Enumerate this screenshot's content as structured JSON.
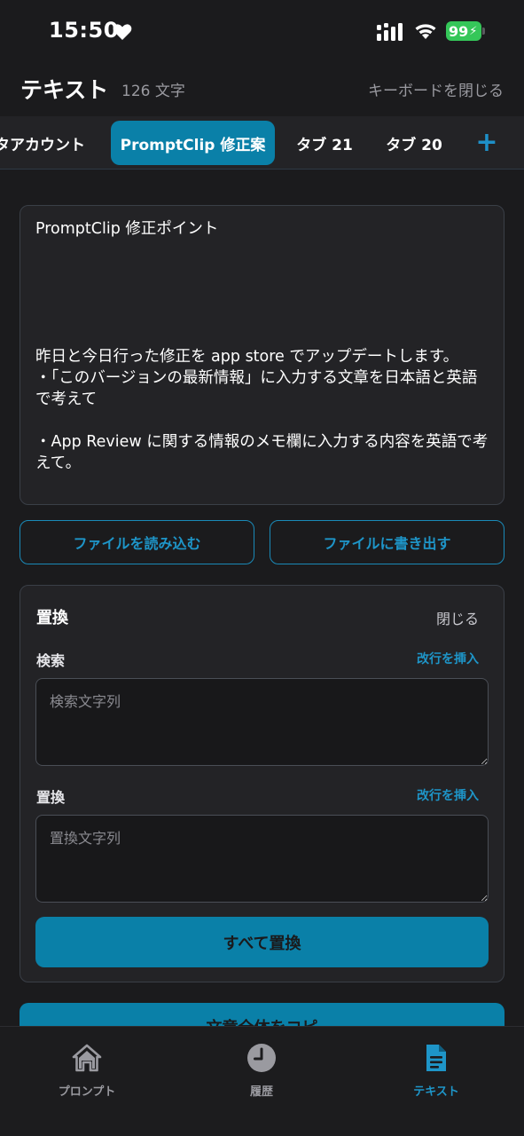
{
  "status_bar": {
    "time": "15:50",
    "battery": "99"
  },
  "header": {
    "title": "テキスト",
    "char_count": "126 文字",
    "close_keyboard": "キーボードを閉じる"
  },
  "tabs": {
    "items": [
      {
        "label": "タアカウント"
      },
      {
        "label": "PromptClip 修正案",
        "active": true
      },
      {
        "label": "タブ 21"
      },
      {
        "label": "タブ 20"
      }
    ],
    "add_label": "+"
  },
  "editor": {
    "lines": [
      "PromptClip 修正ポイント",
      "",
      "",
      "",
      "",
      "",
      "昨日と今日行った修正を app store でアップデートします。",
      "・「このバージョンの最新情報」に入力する文章を日本語と英語で考えて",
      "",
      "・App Review に関する情報のメモ欄に入力する内容を英語で考えて。"
    ]
  },
  "file_actions": {
    "read": "ファイルを読み込む",
    "write": "ファイルに書き出す"
  },
  "replace_panel": {
    "title": "置換",
    "close": "閉じる",
    "search_label": "検索",
    "search_insert_newline": "改行を挿入",
    "search_placeholder": "検索文字列",
    "replace_label": "置換",
    "replace_insert_newline": "改行を挿入",
    "replace_placeholder": "置換文字列",
    "replace_all": "すべて置換"
  },
  "copy_all": "文章全体をコピ",
  "bottom_nav": {
    "items": [
      {
        "label": "プロンプト",
        "icon": "home-icon"
      },
      {
        "label": "履歴",
        "icon": "clock-icon"
      },
      {
        "label": "テキスト",
        "icon": "document-icon",
        "active": true
      }
    ]
  },
  "colors": {
    "accent": "#0a80a8",
    "accent_text": "#1e95c8",
    "background": "#1b1b1d",
    "battery": "#35c759"
  }
}
